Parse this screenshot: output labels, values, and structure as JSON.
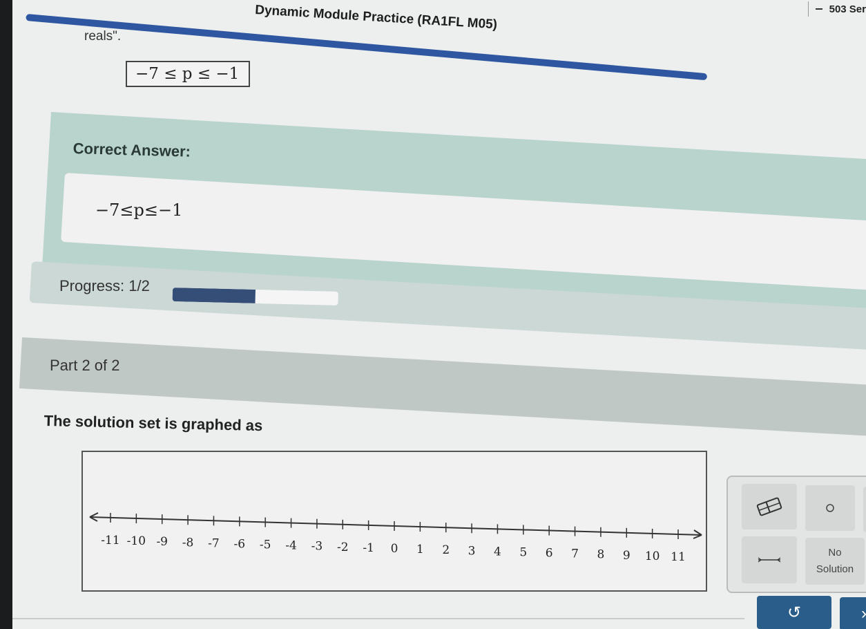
{
  "header": {
    "title": "Dynamic Module Practice (RA1FL M05)",
    "right_text": "503 Ser"
  },
  "previous": {
    "text": "reals\".",
    "answer": "−7 ≤ p ≤ −1"
  },
  "correct": {
    "label": "Correct Answer:",
    "value": "−7≤p≤−1"
  },
  "progress": {
    "label": "Progress: 1/2",
    "fraction": 0.5
  },
  "part": {
    "label": "Part 2 of 2"
  },
  "question": {
    "text": "The solution set is graphed as"
  },
  "number_line": {
    "ticks": [
      "-11",
      "-10",
      "-9",
      "-8",
      "-7",
      "-6",
      "-5",
      "-4",
      "-3",
      "-2",
      "-1",
      "0",
      "1",
      "2",
      "3",
      "4",
      "5",
      "6",
      "7",
      "8",
      "9",
      "10",
      "11"
    ]
  },
  "tools": {
    "eraser_icon": "eraser-icon",
    "circle_icon": "open-circle-icon",
    "segment_icon": "segment-icon",
    "no_solution_line1": "No",
    "no_solution_line2": "Solution"
  },
  "buttons": {
    "undo_icon": "undo-icon",
    "next_icon": "chevron-right-icon"
  },
  "colors": {
    "accent_blue": "#2f56a0",
    "correct_panel": "#b9d3cd",
    "progress_fill": "#344e78",
    "button_blue": "#2a5d8a"
  }
}
